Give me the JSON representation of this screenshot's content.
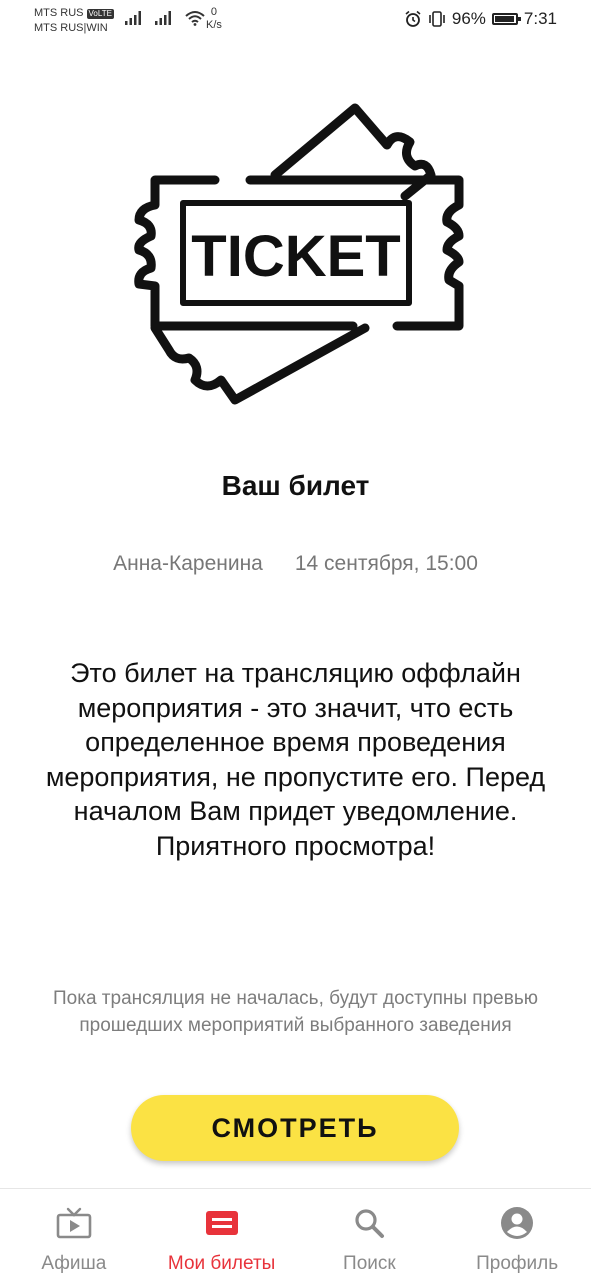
{
  "status_bar": {
    "carrier1": "MTS RUS",
    "volte": "VoLTE",
    "carrier2": "MTS RUS|WIN",
    "net_speed_value": "0",
    "net_speed_unit": "K/s",
    "battery": "96%",
    "time": "7:31"
  },
  "ticket": {
    "illustration_text": "TICKET",
    "title": "Ваш билет",
    "event_name": "Анна-Каренина",
    "event_datetime": "14 сентября, 15:00",
    "description": "Это билет на трансляцию оффлайн мероприятия - это значит, что есть определенное время проведения мероприятия, не пропустите его. Перед началом Вам придет уведомление. Приятного просмотра!",
    "note": "Пока трансялция не началась, будут доступны превью прошедших мероприятий выбранного заведения",
    "watch_button": "СМОТРЕТЬ"
  },
  "bottom_nav": {
    "items": [
      {
        "label": "Афиша",
        "icon": "tv-play-icon",
        "active": false
      },
      {
        "label": "Мои билеты",
        "icon": "ticket-icon",
        "active": true
      },
      {
        "label": "Поиск",
        "icon": "search-icon",
        "active": false
      },
      {
        "label": "Профиль",
        "icon": "profile-icon",
        "active": false
      }
    ]
  },
  "colors": {
    "accent_yellow": "#fbe244",
    "active_red": "#e8333b",
    "inactive_gray": "#8a8a8a",
    "secondary_text": "#777777"
  }
}
